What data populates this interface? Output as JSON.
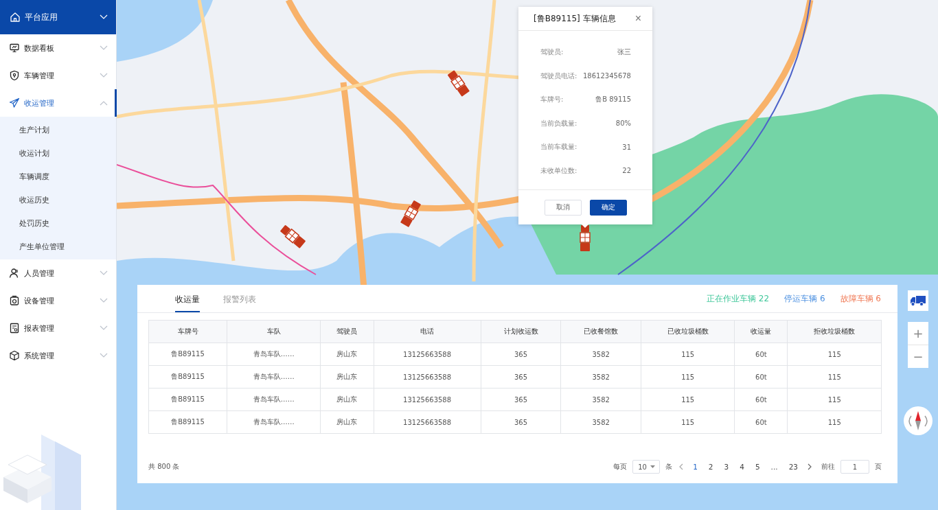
{
  "sidebar": {
    "header": {
      "label": "平台应用",
      "expanded": false
    },
    "items": [
      {
        "label": "数据看板",
        "expanded": false,
        "selected": false
      },
      {
        "label": "车辆管理",
        "expanded": false,
        "selected": false
      },
      {
        "label": "收运管理",
        "expanded": true,
        "selected": true,
        "children": [
          {
            "label": "生产计划",
            "selected": false
          },
          {
            "label": "收运计划",
            "selected": false
          },
          {
            "label": "车辆调度",
            "selected": false
          },
          {
            "label": "收运历史",
            "selected": false
          },
          {
            "label": "处罚历史",
            "selected": false
          },
          {
            "label": "产生单位管理",
            "selected": false
          }
        ]
      },
      {
        "label": "人员管理",
        "expanded": false,
        "selected": false
      },
      {
        "label": "设备管理",
        "expanded": false,
        "selected": false
      },
      {
        "label": "报表管理",
        "expanded": false,
        "selected": false
      },
      {
        "label": "系统管理",
        "expanded": false,
        "selected": false
      }
    ]
  },
  "vehicle_popup": {
    "title": "[鲁B89115] 车辆信息",
    "close": "×",
    "fields": [
      {
        "label": "驾驶员:",
        "value": "张三"
      },
      {
        "label": "驾驶员电话:",
        "value": "18612345678"
      },
      {
        "label": "车牌号:",
        "value": "鲁B 89115"
      },
      {
        "label": "当前负载量:",
        "value": "80%"
      },
      {
        "label": "当前车载量:",
        "value": "31"
      },
      {
        "label": "未收单位数:",
        "value": "22"
      }
    ],
    "buttons": [
      {
        "label": "取消",
        "kind": "secondary"
      },
      {
        "label": "确定",
        "kind": "primary"
      }
    ]
  },
  "panel": {
    "tabs": [
      {
        "label": "收运量",
        "selected": true
      },
      {
        "label": "报警列表",
        "selected": false
      }
    ],
    "stats": [
      {
        "label": "正在作业车辆",
        "count": "22",
        "color": "#3fc79a"
      },
      {
        "label": "停运车辆",
        "count": "6",
        "color": "#4a8fe0"
      },
      {
        "label": "故障车辆",
        "count": "6",
        "color": "#f07a56"
      }
    ],
    "table": {
      "columns": [
        "车牌号",
        "车队",
        "驾驶员",
        "电话",
        "计划收运数",
        "已收餐馆数",
        "已收垃圾桶数",
        "收运量",
        "拒收垃圾桶数"
      ],
      "rows": [
        [
          "鲁B89115",
          "青岛车队……",
          "房山东",
          "13125663588",
          "365",
          "3582",
          "115",
          "60t",
          "115"
        ],
        [
          "鲁B89115",
          "青岛车队……",
          "房山东",
          "13125663588",
          "365",
          "3582",
          "115",
          "60t",
          "115"
        ],
        [
          "鲁B89115",
          "青岛车队……",
          "房山东",
          "13125663588",
          "365",
          "3582",
          "115",
          "60t",
          "115"
        ],
        [
          "鲁B89115",
          "青岛车队……",
          "房山东",
          "13125663588",
          "365",
          "3582",
          "115",
          "60t",
          "115"
        ]
      ]
    },
    "pagination": {
      "total": "共 800 条",
      "per_page_label": "每页",
      "per_page": "10",
      "per_page_unit": "条",
      "pages": [
        {
          "label": "1",
          "selected": true
        },
        {
          "label": "2",
          "selected": false
        },
        {
          "label": "3",
          "selected": false
        },
        {
          "label": "4",
          "selected": false
        },
        {
          "label": "5",
          "selected": false
        },
        {
          "label": "...",
          "selected": false
        },
        {
          "label": "23",
          "selected": false
        }
      ],
      "goto_label": "前往",
      "goto_value": "1",
      "goto_unit": "页"
    }
  },
  "map_controls": {
    "zoom_in": "+",
    "zoom_out": "−"
  }
}
